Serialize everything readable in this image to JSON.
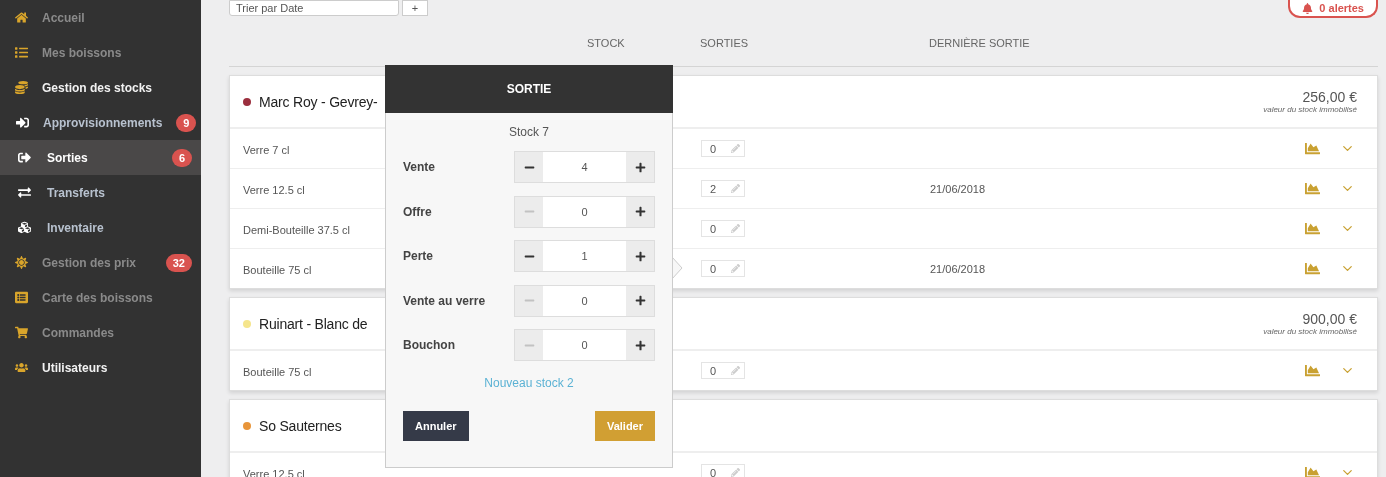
{
  "sidebar": {
    "items": [
      {
        "label": "Accueil",
        "dimmed": true,
        "selected": false
      },
      {
        "label": "Mes boissons",
        "dimmed": true,
        "selected": false
      },
      {
        "label": "Gestion des stocks",
        "dimmed": false,
        "selected": false,
        "children": [
          {
            "label": "Approvisionnements",
            "badge": "9",
            "selected": false
          },
          {
            "label": "Sorties",
            "badge": "6",
            "selected": true
          },
          {
            "label": "Transferts",
            "selected": false
          },
          {
            "label": "Inventaire",
            "selected": false
          }
        ]
      },
      {
        "label": "Gestion des prix",
        "dimmed": true,
        "selected": false,
        "badge": "32"
      },
      {
        "label": "Carte des boissons",
        "dimmed": true,
        "selected": false
      },
      {
        "label": "Commandes",
        "dimmed": true,
        "selected": false
      },
      {
        "label": "Utilisateurs",
        "dimmed": false,
        "selected": false
      }
    ]
  },
  "toolbar": {
    "sort_select": "Trier par Date",
    "add_button": "+",
    "alerts_button": "0 alertes"
  },
  "table": {
    "columns": [
      "STOCK",
      "SORTIES",
      "DERNIÈRE SORTIE"
    ],
    "groups": [
      {
        "name": "Marc Roy - Gevrey-",
        "color": "#9b2f3e",
        "value": "256,00 €",
        "value_caption": "valeur du stock immobilisé",
        "rows": [
          {
            "label": "Verre 7 cl",
            "sorties": "0",
            "last": ""
          },
          {
            "label": "Verre 12.5 cl",
            "sorties": "2",
            "last": "21/06/2018"
          },
          {
            "label": "Demi-Bouteille 37.5 cl",
            "sorties": "0",
            "last": ""
          },
          {
            "label": "Bouteille 75 cl",
            "sorties": "0",
            "last": "21/06/2018"
          }
        ]
      },
      {
        "name": "Ruinart - Blanc de",
        "color": "#f5e58c",
        "value": "900,00 €",
        "value_caption": "valeur du stock immobilisé",
        "rows": [
          {
            "label": "Bouteille 75 cl",
            "sorties": "0",
            "last": ""
          }
        ]
      },
      {
        "name": "So Sauternes",
        "color": "#e8953a",
        "rows": [
          {
            "label": "Verre 12.5 cl",
            "sorties": "0",
            "last": ""
          }
        ]
      }
    ]
  },
  "popup": {
    "title": "SORTIE",
    "subtitle": "Stock 7",
    "fields": [
      {
        "label": "Vente",
        "value": "4",
        "minus_disabled": false
      },
      {
        "label": "Offre",
        "value": "0",
        "minus_disabled": true
      },
      {
        "label": "Perte",
        "value": "1",
        "minus_disabled": false
      },
      {
        "label": "Vente au verre",
        "value": "0",
        "minus_disabled": true
      },
      {
        "label": "Bouchon",
        "value": "0",
        "minus_disabled": true
      }
    ],
    "link": "Nouveau stock 2",
    "cancel": "Annuler",
    "confirm": "Valider"
  }
}
